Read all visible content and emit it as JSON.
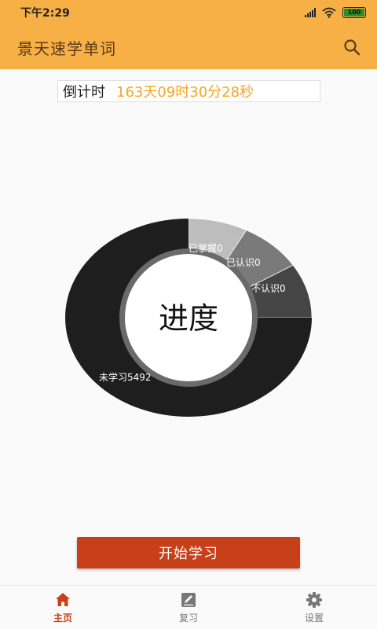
{
  "status_bar": {
    "time": "下午2:29",
    "battery": "100"
  },
  "app_bar": {
    "title": "景天速学单词",
    "search_icon": "search-icon"
  },
  "countdown": {
    "label": "倒计时",
    "value": "163天09时30分28秒"
  },
  "progress": {
    "center_text": "进度",
    "segments": [
      {
        "label": "已掌握0",
        "color": "#bdbdbd"
      },
      {
        "label": "已认识0",
        "color": "#7a7a7a"
      },
      {
        "label": "不认识0",
        "color": "#454545"
      },
      {
        "label": "未学习5492",
        "color": "#1e1e1e"
      }
    ]
  },
  "start_button": {
    "label": "开始学习",
    "color": "#c8401a"
  },
  "bottom_nav": {
    "items": [
      {
        "label": "主页",
        "icon": "home-icon",
        "active": true
      },
      {
        "label": "复习",
        "icon": "edit-icon",
        "active": false
      },
      {
        "label": "设置",
        "icon": "gear-icon",
        "active": false
      }
    ]
  },
  "colors": {
    "accent": "#f7b046",
    "primary": "#c8401a",
    "countdown": "#f5a623"
  }
}
